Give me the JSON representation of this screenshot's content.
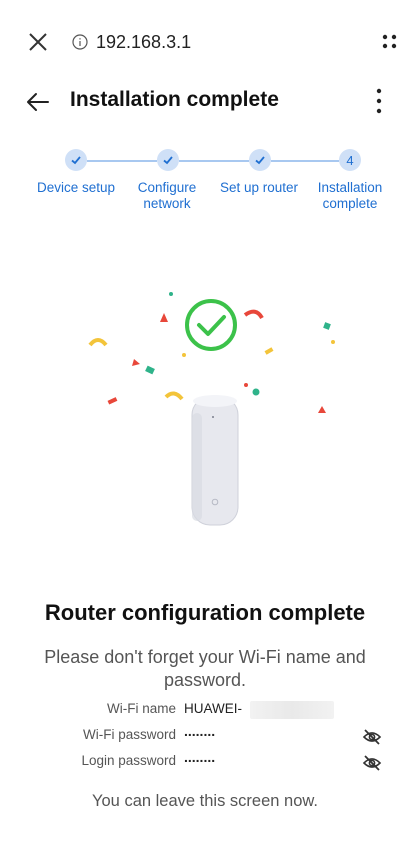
{
  "browser": {
    "url": "192.168.3.1"
  },
  "header": {
    "title": "Installation complete"
  },
  "stepper": {
    "steps": [
      {
        "label": "Device setup",
        "status": "done"
      },
      {
        "label": "Configure network",
        "status": "done"
      },
      {
        "label": "Set up router",
        "status": "done"
      },
      {
        "label": "Installation complete",
        "status": "current",
        "number": "4"
      }
    ]
  },
  "result": {
    "title": "Router configuration complete",
    "reminder": "Please don't forget your Wi-Fi name and password.",
    "wifi_name_label": "Wi-Fi name",
    "wifi_name_value": "HUAWEI-",
    "wifi_password_label": "Wi-Fi password",
    "wifi_password_value": "........",
    "login_password_label": "Login password",
    "login_password_value": "........",
    "leave_text": "You can leave this screen now."
  },
  "colors": {
    "accent": "#1f6fd1",
    "success": "#3cc24a"
  }
}
